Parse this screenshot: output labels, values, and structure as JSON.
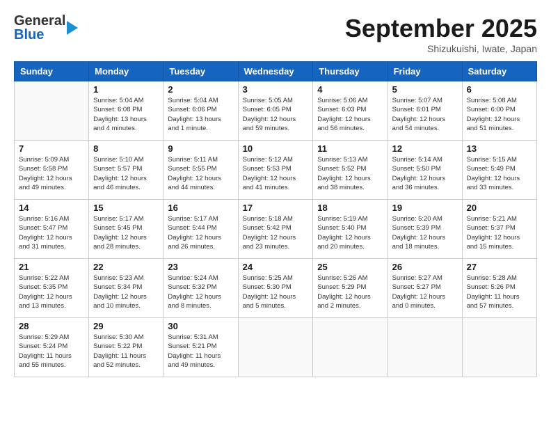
{
  "header": {
    "logo_line1": "General",
    "logo_line2": "Blue",
    "month_title": "September 2025",
    "subtitle": "Shizukuishi, Iwate, Japan"
  },
  "weekdays": [
    "Sunday",
    "Monday",
    "Tuesday",
    "Wednesday",
    "Thursday",
    "Friday",
    "Saturday"
  ],
  "weeks": [
    [
      {
        "day": "",
        "info": ""
      },
      {
        "day": "1",
        "info": "Sunrise: 5:04 AM\nSunset: 6:08 PM\nDaylight: 13 hours\nand 4 minutes."
      },
      {
        "day": "2",
        "info": "Sunrise: 5:04 AM\nSunset: 6:06 PM\nDaylight: 13 hours\nand 1 minute."
      },
      {
        "day": "3",
        "info": "Sunrise: 5:05 AM\nSunset: 6:05 PM\nDaylight: 12 hours\nand 59 minutes."
      },
      {
        "day": "4",
        "info": "Sunrise: 5:06 AM\nSunset: 6:03 PM\nDaylight: 12 hours\nand 56 minutes."
      },
      {
        "day": "5",
        "info": "Sunrise: 5:07 AM\nSunset: 6:01 PM\nDaylight: 12 hours\nand 54 minutes."
      },
      {
        "day": "6",
        "info": "Sunrise: 5:08 AM\nSunset: 6:00 PM\nDaylight: 12 hours\nand 51 minutes."
      }
    ],
    [
      {
        "day": "7",
        "info": "Sunrise: 5:09 AM\nSunset: 5:58 PM\nDaylight: 12 hours\nand 49 minutes."
      },
      {
        "day": "8",
        "info": "Sunrise: 5:10 AM\nSunset: 5:57 PM\nDaylight: 12 hours\nand 46 minutes."
      },
      {
        "day": "9",
        "info": "Sunrise: 5:11 AM\nSunset: 5:55 PM\nDaylight: 12 hours\nand 44 minutes."
      },
      {
        "day": "10",
        "info": "Sunrise: 5:12 AM\nSunset: 5:53 PM\nDaylight: 12 hours\nand 41 minutes."
      },
      {
        "day": "11",
        "info": "Sunrise: 5:13 AM\nSunset: 5:52 PM\nDaylight: 12 hours\nand 38 minutes."
      },
      {
        "day": "12",
        "info": "Sunrise: 5:14 AM\nSunset: 5:50 PM\nDaylight: 12 hours\nand 36 minutes."
      },
      {
        "day": "13",
        "info": "Sunrise: 5:15 AM\nSunset: 5:49 PM\nDaylight: 12 hours\nand 33 minutes."
      }
    ],
    [
      {
        "day": "14",
        "info": "Sunrise: 5:16 AM\nSunset: 5:47 PM\nDaylight: 12 hours\nand 31 minutes."
      },
      {
        "day": "15",
        "info": "Sunrise: 5:17 AM\nSunset: 5:45 PM\nDaylight: 12 hours\nand 28 minutes."
      },
      {
        "day": "16",
        "info": "Sunrise: 5:17 AM\nSunset: 5:44 PM\nDaylight: 12 hours\nand 26 minutes."
      },
      {
        "day": "17",
        "info": "Sunrise: 5:18 AM\nSunset: 5:42 PM\nDaylight: 12 hours\nand 23 minutes."
      },
      {
        "day": "18",
        "info": "Sunrise: 5:19 AM\nSunset: 5:40 PM\nDaylight: 12 hours\nand 20 minutes."
      },
      {
        "day": "19",
        "info": "Sunrise: 5:20 AM\nSunset: 5:39 PM\nDaylight: 12 hours\nand 18 minutes."
      },
      {
        "day": "20",
        "info": "Sunrise: 5:21 AM\nSunset: 5:37 PM\nDaylight: 12 hours\nand 15 minutes."
      }
    ],
    [
      {
        "day": "21",
        "info": "Sunrise: 5:22 AM\nSunset: 5:35 PM\nDaylight: 12 hours\nand 13 minutes."
      },
      {
        "day": "22",
        "info": "Sunrise: 5:23 AM\nSunset: 5:34 PM\nDaylight: 12 hours\nand 10 minutes."
      },
      {
        "day": "23",
        "info": "Sunrise: 5:24 AM\nSunset: 5:32 PM\nDaylight: 12 hours\nand 8 minutes."
      },
      {
        "day": "24",
        "info": "Sunrise: 5:25 AM\nSunset: 5:30 PM\nDaylight: 12 hours\nand 5 minutes."
      },
      {
        "day": "25",
        "info": "Sunrise: 5:26 AM\nSunset: 5:29 PM\nDaylight: 12 hours\nand 2 minutes."
      },
      {
        "day": "26",
        "info": "Sunrise: 5:27 AM\nSunset: 5:27 PM\nDaylight: 12 hours\nand 0 minutes."
      },
      {
        "day": "27",
        "info": "Sunrise: 5:28 AM\nSunset: 5:26 PM\nDaylight: 11 hours\nand 57 minutes."
      }
    ],
    [
      {
        "day": "28",
        "info": "Sunrise: 5:29 AM\nSunset: 5:24 PM\nDaylight: 11 hours\nand 55 minutes."
      },
      {
        "day": "29",
        "info": "Sunrise: 5:30 AM\nSunset: 5:22 PM\nDaylight: 11 hours\nand 52 minutes."
      },
      {
        "day": "30",
        "info": "Sunrise: 5:31 AM\nSunset: 5:21 PM\nDaylight: 11 hours\nand 49 minutes."
      },
      {
        "day": "",
        "info": ""
      },
      {
        "day": "",
        "info": ""
      },
      {
        "day": "",
        "info": ""
      },
      {
        "day": "",
        "info": ""
      }
    ]
  ]
}
